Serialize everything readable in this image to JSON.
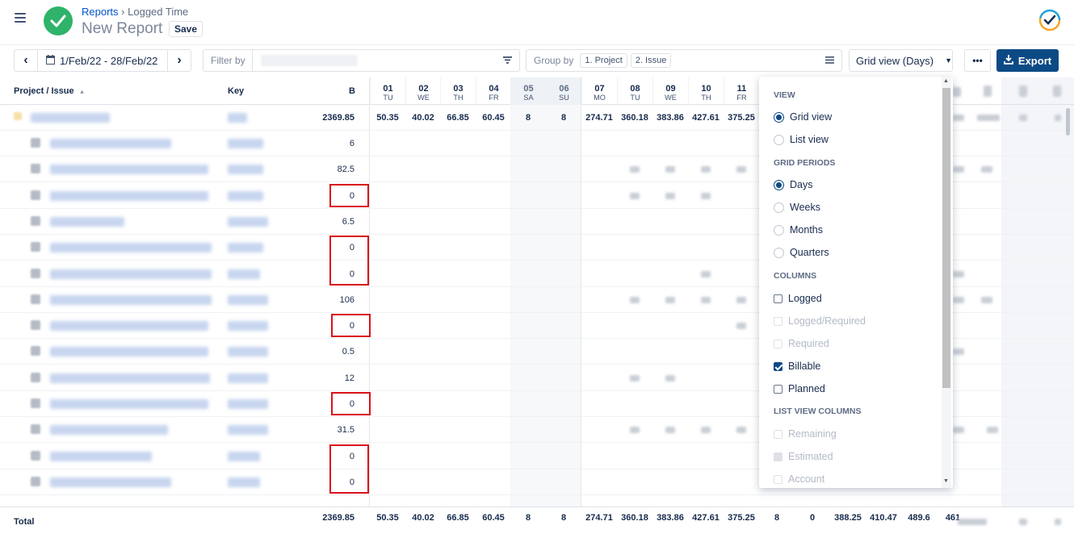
{
  "header": {
    "breadcrumb_parent": "Reports",
    "breadcrumb_sep": "›",
    "breadcrumb_current": "Logged Time",
    "title": "New Report",
    "save_label": "Save"
  },
  "toolbar": {
    "date_range": "1/Feb/22 - 28/Feb/22",
    "filter_label": "Filter by",
    "group_label": "Group by",
    "group_chips": [
      "1. Project",
      "2. Issue"
    ],
    "view_select": "Grid view (Days)",
    "more_label": "•••",
    "export_label": "Export"
  },
  "table": {
    "col_project": "Project / Issue",
    "col_key": "Key",
    "col_b": "B",
    "days": [
      {
        "num": "01",
        "dow": "TU",
        "weekend": false
      },
      {
        "num": "02",
        "dow": "WE",
        "weekend": false
      },
      {
        "num": "03",
        "dow": "TH",
        "weekend": false
      },
      {
        "num": "04",
        "dow": "FR",
        "weekend": false
      },
      {
        "num": "05",
        "dow": "SA",
        "weekend": true
      },
      {
        "num": "06",
        "dow": "SU",
        "weekend": true
      },
      {
        "num": "07",
        "dow": "MO",
        "weekend": false
      },
      {
        "num": "08",
        "dow": "TU",
        "weekend": false
      },
      {
        "num": "09",
        "dow": "WE",
        "weekend": false
      },
      {
        "num": "10",
        "dow": "TH",
        "weekend": false
      },
      {
        "num": "11",
        "dow": "FR",
        "weekend": false
      }
    ],
    "group_row": {
      "b": "2369.85",
      "days": [
        "50.35",
        "40.02",
        "66.85",
        "60.45",
        "8",
        "8",
        "274.71",
        "360.18",
        "383.86",
        "427.61",
        "375.25"
      ]
    },
    "rows_b": [
      "6",
      "82.5",
      "0",
      "6.5",
      "0",
      "0",
      "106",
      "0",
      "0.5",
      "12",
      "0",
      "31.5",
      "0",
      "0"
    ],
    "highlighted_rows": [
      2,
      4,
      5,
      7,
      10,
      12,
      13
    ],
    "total": {
      "label": "Total",
      "b": "2369.85",
      "days": [
        "50.35",
        "40.02",
        "66.85",
        "60.45",
        "8",
        "8",
        "274.71",
        "360.18",
        "383.86",
        "427.61",
        "375.25",
        "8",
        "0",
        "388.25",
        "410.47",
        "489.6",
        "461"
      ]
    }
  },
  "dropdown": {
    "sec_view": "VIEW",
    "grid_view": "Grid view",
    "list_view": "List view",
    "sec_periods": "GRID PERIODS",
    "days": "Days",
    "weeks": "Weeks",
    "months": "Months",
    "quarters": "Quarters",
    "sec_columns": "COLUMNS",
    "logged": "Logged",
    "logged_required": "Logged/Required",
    "required": "Required",
    "billable": "Billable",
    "planned": "Planned",
    "sec_list_cols": "LIST VIEW COLUMNS",
    "remaining": "Remaining",
    "estimated": "Estimated",
    "account": "Account"
  },
  "colors": {
    "accent": "#0c4a85",
    "brand_green": "#2fb36b",
    "highlight": "#d9121b"
  }
}
